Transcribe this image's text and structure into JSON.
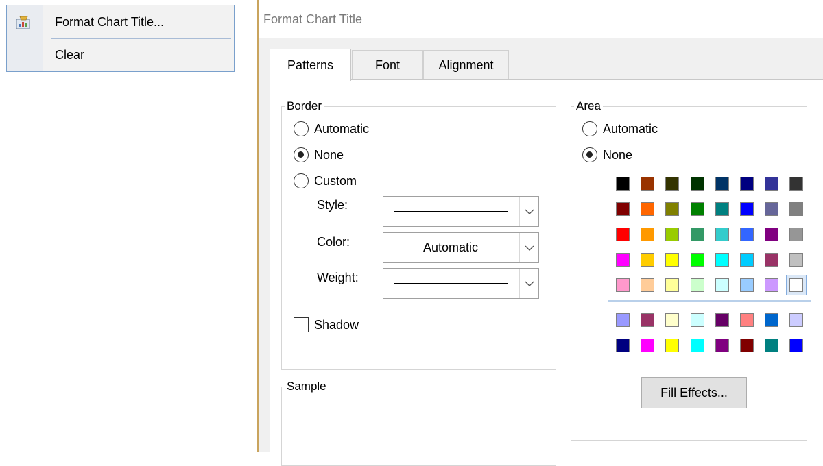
{
  "context_menu": {
    "items": [
      {
        "label": "Format Chart Title...",
        "icon": "format-chart-icon"
      },
      {
        "label": "Clear"
      }
    ]
  },
  "dialog": {
    "title": "Format Chart Title",
    "tabs": [
      {
        "label": "Patterns",
        "active": true
      },
      {
        "label": "Font"
      },
      {
        "label": "Alignment"
      }
    ],
    "border_group": {
      "legend": "Border",
      "options": [
        {
          "label": "Automatic",
          "checked": false
        },
        {
          "label": "None",
          "checked": true
        },
        {
          "label": "Custom",
          "checked": false
        }
      ],
      "style_label": "Style:",
      "color_label": "Color:",
      "color_value": "Automatic",
      "weight_label": "Weight:",
      "shadow_label": "Shadow",
      "shadow_checked": false
    },
    "sample_group": {
      "legend": "Sample"
    },
    "area_group": {
      "legend": "Area",
      "options": [
        {
          "label": "Automatic",
          "checked": false
        },
        {
          "label": "None",
          "checked": true
        }
      ],
      "standard_colors": [
        [
          "#000000",
          "#993300",
          "#333300",
          "#003300",
          "#003366",
          "#000080",
          "#333399",
          "#333333"
        ],
        [
          "#800000",
          "#ff6600",
          "#808000",
          "#008000",
          "#008080",
          "#0000ff",
          "#666699",
          "#808080"
        ],
        [
          "#ff0000",
          "#ff9900",
          "#99cc00",
          "#339966",
          "#33cccc",
          "#3366ff",
          "#800080",
          "#969696"
        ],
        [
          "#ff00ff",
          "#ffcc00",
          "#ffff00",
          "#00ff00",
          "#00ffff",
          "#00ccff",
          "#993366",
          "#c0c0c0"
        ],
        [
          "#ff99cc",
          "#ffcc99",
          "#ffff99",
          "#ccffcc",
          "#ccffff",
          "#99ccff",
          "#cc99ff",
          "#ffffff"
        ]
      ],
      "chart_colors": [
        [
          "#9999ff",
          "#993366",
          "#ffffcc",
          "#ccffff",
          "#660066",
          "#ff8080",
          "#0066cc",
          "#ccccff"
        ],
        [
          "#000080",
          "#ff00ff",
          "#ffff00",
          "#00ffff",
          "#800080",
          "#800000",
          "#008080",
          "#0000ff"
        ]
      ],
      "selected_color": "#ffffff",
      "fill_effects_label": "Fill Effects..."
    }
  }
}
